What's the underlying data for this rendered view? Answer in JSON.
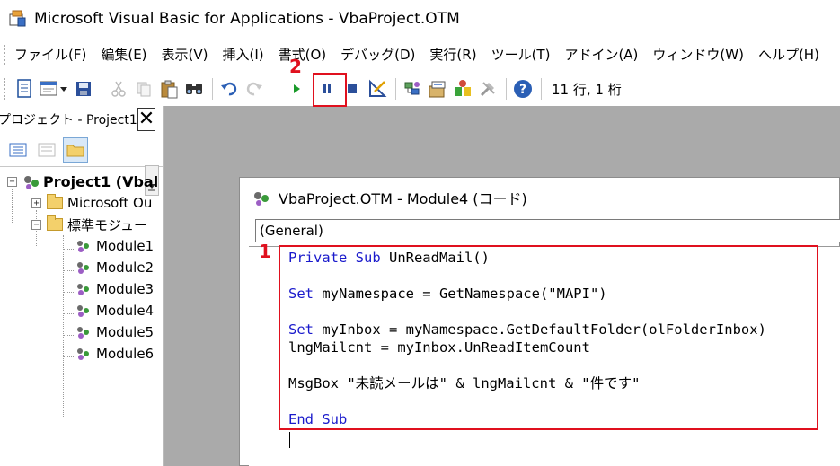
{
  "window": {
    "title": "Microsoft Visual Basic for Applications - VbaProject.OTM"
  },
  "menu": {
    "items": [
      "ファイル(F)",
      "編集(E)",
      "表示(V)",
      "挿入(I)",
      "書式(O)",
      "デバッグ(D)",
      "実行(R)",
      "ツール(T)",
      "アドイン(A)",
      "ウィンドウ(W)",
      "ヘルプ(H)"
    ]
  },
  "toolbar": {
    "cursor_position": "11 行, 1 桁",
    "icons": [
      "view-excel-icon",
      "insert-userform-icon",
      "save-icon",
      "cut-icon",
      "copy-icon",
      "paste-icon",
      "find-icon",
      "undo-icon",
      "redo-icon",
      "run-icon",
      "break-icon",
      "reset-icon",
      "design-mode-icon",
      "project-explorer-icon",
      "properties-window-icon",
      "object-browser-icon",
      "toolbox-icon",
      "help-icon"
    ]
  },
  "project_panel": {
    "title": "プロジェクト - Project1",
    "tree": {
      "root": "Project1 (Vbal",
      "folder_outlook": "Microsoft Ou",
      "folder_modules": "標準モジュー",
      "modules": [
        "Module1",
        "Module2",
        "Module3",
        "Module4",
        "Module5",
        "Module6"
      ]
    }
  },
  "code_window": {
    "title": "VbaProject.OTM - Module4 (コード)",
    "object_combo": "(General)",
    "lines": [
      {
        "kw": "Private Sub ",
        "rest": "UnReadMail()"
      },
      {
        "kw": "",
        "rest": ""
      },
      {
        "kw": "Set ",
        "rest": "myNamespace = GetNamespace(\"MAPI\")"
      },
      {
        "kw": "",
        "rest": ""
      },
      {
        "kw": "Set ",
        "rest": "myInbox = myNamespace.GetDefaultFolder(olFolderInbox)"
      },
      {
        "kw": "",
        "rest": "lngMailcnt = myInbox.UnReadItemCount"
      },
      {
        "kw": "",
        "rest": ""
      },
      {
        "kw": "",
        "rest": "MsgBox \"未読メールは\" & lngMailcnt & \"件です\""
      },
      {
        "kw": "",
        "rest": ""
      },
      {
        "kw": "End Sub",
        "rest": ""
      }
    ]
  },
  "annotations": {
    "step1": "1",
    "step2": "2"
  },
  "colors": {
    "accent_red": "#e0101e",
    "keyword_blue": "#1a1acc",
    "mdi_gray": "#aaaaaa"
  }
}
